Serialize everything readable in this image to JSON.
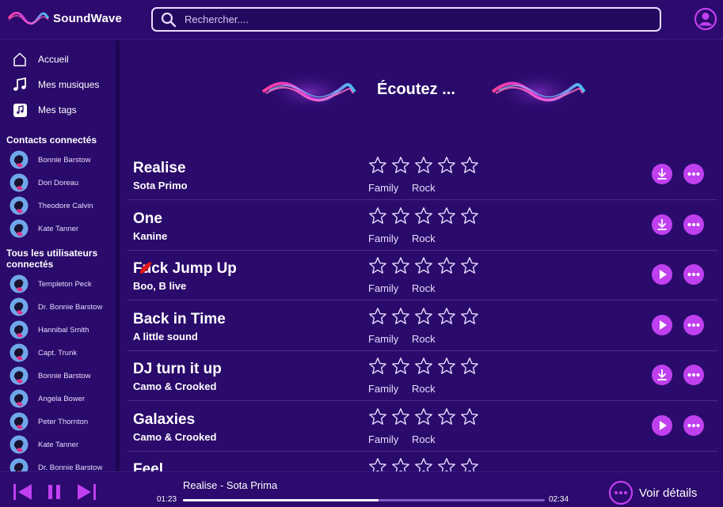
{
  "app": {
    "title": "SoundWave"
  },
  "search": {
    "placeholder": "Rechercher...."
  },
  "nav": [
    {
      "label": "Accueil",
      "icon": "home-icon"
    },
    {
      "label": "Mes musiques",
      "icon": "music-note-icon"
    },
    {
      "label": "Mes tags",
      "icon": "tag-music-icon"
    }
  ],
  "sidebar": {
    "connected_title": "Contacts connectés",
    "connected": [
      "Bonnie Barstow",
      "Dori Doreau",
      "Theodore Calvin",
      "Kate Tanner"
    ],
    "all_title": "Tous les utilisateurs connectés",
    "all": [
      "Templeton Peck",
      "Dr. Bonnie Barstow",
      "Hannibal Smith",
      "Capt. Trunk",
      "Bonnie Barstow",
      "Angela Bower",
      "Peter Thornton",
      "Kate Tanner",
      "Dr. Bonnie Barstow"
    ]
  },
  "hero": {
    "title": "Écoutez ..."
  },
  "tracks": [
    {
      "title": "Realise",
      "artist": "Sota Primo",
      "rating": 0,
      "tags": [
        "Family",
        "Rock"
      ],
      "action": "download"
    },
    {
      "title": "One",
      "artist": "Kanine",
      "rating": 0,
      "tags": [
        "Family",
        "Rock"
      ],
      "action": "download"
    },
    {
      "title": "Fuck Jump Up",
      "artist": "Boo, B live",
      "rating": 0,
      "tags": [
        "Family",
        "Rock"
      ],
      "action": "play"
    },
    {
      "title": "Back in Time",
      "artist": "A little sound",
      "rating": 0,
      "tags": [
        "Family",
        "Rock"
      ],
      "action": "play"
    },
    {
      "title": "DJ turn it up",
      "artist": "Camo & Crooked",
      "rating": 0,
      "tags": [
        "Family",
        "Rock"
      ],
      "action": "download"
    },
    {
      "title": "Galaxies",
      "artist": "Camo & Crooked",
      "rating": 0,
      "tags": [
        "Family",
        "Rock"
      ],
      "action": "play"
    },
    {
      "title": "Feel",
      "artist": "",
      "rating": 0,
      "tags": [],
      "action": ""
    }
  ],
  "player": {
    "now_playing": "Realise - Sota Prima",
    "elapsed": "01:23",
    "duration": "02:34",
    "progress": 0.54,
    "details_label": "Voir détails"
  },
  "colors": {
    "accent": "#c040f0",
    "background": "#2a0a6b",
    "divider": "#4a2a92"
  }
}
